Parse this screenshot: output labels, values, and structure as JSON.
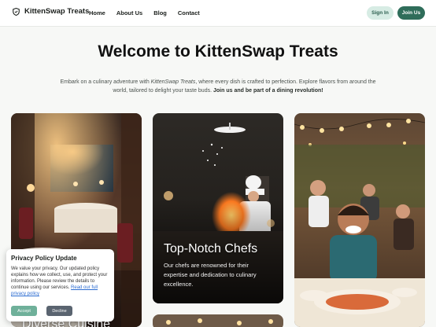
{
  "nav": {
    "brand": "KittenSwap Treats",
    "brand_icon": "shield-icon",
    "links": [
      "Home",
      "About Us",
      "Blog",
      "Contact"
    ],
    "signin_label": "Sign In",
    "join_label": "Join Us"
  },
  "hero": {
    "title": "Welcome to KittenSwap Treats",
    "sub_part1": "Embark on a culinary adventure with ",
    "sub_italic": "KittenSwap Treats",
    "sub_part2": ", where every dish is crafted to perfection. Explore flavors from around the world, tailored to delight your taste buds. ",
    "sub_bold": "Join us and be part of a dining revolution!"
  },
  "cards": [
    {
      "title": "Diverse Cuisine",
      "description": ""
    },
    {
      "title": "Top-Notch Chefs",
      "description": "Our chefs are renowned for their expertise and dedication to culinary excellence."
    },
    {
      "title": "",
      "description": ""
    }
  ],
  "cookie": {
    "title": "Privacy Policy Update",
    "text": "We value your privacy. Our updated policy explains how we collect, use, and protect your information. Please review the details to continue using our services. ",
    "link": "Read our full privacy policy",
    "accept_label": "Accept",
    "decline_label": "Decline"
  },
  "colors": {
    "accent": "#2f6d5a",
    "accent_light": "#d7ece4",
    "accept": "#6fb09a",
    "decline": "#5a6470"
  }
}
